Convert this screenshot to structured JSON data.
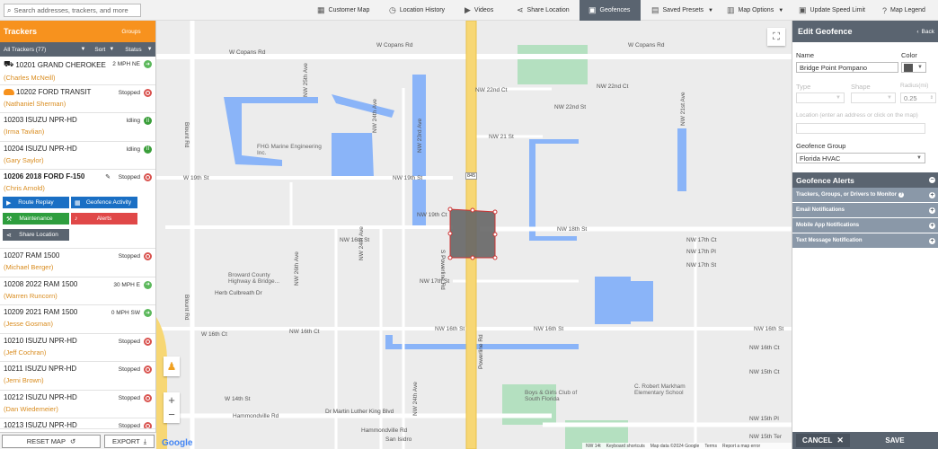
{
  "search": {
    "placeholder": "Search addresses, trackers, and more"
  },
  "nav": [
    {
      "label": "Customer Map"
    },
    {
      "label": "Location History"
    },
    {
      "label": "Videos"
    },
    {
      "label": "Share Location"
    },
    {
      "label": "Geofences"
    },
    {
      "label": "Saved Presets"
    },
    {
      "label": "Map Options"
    },
    {
      "label": "Update Speed Limit"
    },
    {
      "label": "Map Legend"
    }
  ],
  "trackers": {
    "title": "Trackers",
    "groups_label": "Groups",
    "all_label": "All Trackers (77)",
    "sort_label": "Sort",
    "status_label": "Status",
    "items": [
      {
        "name": "10201 GRAND CHEROKEE",
        "driver": "(Charles McNeill)",
        "status": "2 MPH NE",
        "state": "move"
      },
      {
        "name": "10202 FORD TRANSIT",
        "driver": "(Nathaniel Sherman)",
        "status": "Stopped",
        "state": "stop"
      },
      {
        "name": "10203 ISUZU NPR-HD",
        "driver": "(Irma Tavlian)",
        "status": "Idling",
        "state": "idle"
      },
      {
        "name": "10204 ISUZU NPR-HD",
        "driver": "(Gary Saylor)",
        "status": "Idling",
        "state": "idle"
      },
      {
        "name": "10206 2018 FORD F-150",
        "driver": "(Chris Arnold)",
        "status": "Stopped",
        "state": "stop"
      },
      {
        "name": "10207 RAM 1500",
        "driver": "(Michael Berger)",
        "status": "Stopped",
        "state": "stop"
      },
      {
        "name": "10208 2022 RAM 1500",
        "driver": "(Warren Runcorn)",
        "status": "30 MPH E",
        "state": "move"
      },
      {
        "name": "10209 2021 RAM 1500",
        "driver": "(Jesse Gosman)",
        "status": "0 MPH SW",
        "state": "move"
      },
      {
        "name": "10210 ISUZU NPR-HD",
        "driver": "(Jeff Cochran)",
        "status": "Stopped",
        "state": "stop"
      },
      {
        "name": "10211 ISUZU NPR-HD",
        "driver": "(Jerni Brown)",
        "status": "Stopped",
        "state": "stop"
      },
      {
        "name": "10212 ISUZU NPR-HD",
        "driver": "(Dan Wiedemeier)",
        "status": "Stopped",
        "state": "stop"
      },
      {
        "name": "10213 ISUZU NPR-HD",
        "driver": "",
        "status": "Stopped",
        "state": "stop"
      }
    ],
    "actions": {
      "route_replay": "Route Replay",
      "geofence_activity": "Geofence Activity",
      "maintenance": "Maintenance",
      "alerts": "Alerts",
      "share_location": "Share Location"
    },
    "reset_map": "RESET MAP",
    "export": "EXPORT"
  },
  "map": {
    "labels": [
      {
        "t": "W Copans Rd"
      },
      {
        "t": "W Copans Rd"
      },
      {
        "t": "W Copans Rd"
      },
      {
        "t": "NW 22nd Ct"
      },
      {
        "t": "NW 22nd Ct"
      },
      {
        "t": "NW 22nd St"
      },
      {
        "t": "NW 21 St"
      },
      {
        "t": "FHG Marine Engineering Inc."
      },
      {
        "t": "W 19th St"
      },
      {
        "t": "NW 19th St"
      },
      {
        "t": "NW 19th Ct"
      },
      {
        "t": "NW 18th St"
      },
      {
        "t": "NW 16th St"
      },
      {
        "t": "NW 17th St"
      },
      {
        "t": "NW 16th St"
      },
      {
        "t": "NW 16th St"
      },
      {
        "t": "Broward County Highway & Bridge..."
      },
      {
        "t": "Herb Culbreath Dr"
      },
      {
        "t": "W 16th Ct"
      },
      {
        "t": "NW 16th Ct"
      },
      {
        "t": "W 14th St"
      },
      {
        "t": "Dr Martin Luther King Blvd"
      },
      {
        "t": "Hammondville Rd"
      },
      {
        "t": "Hammondville Rd"
      },
      {
        "t": "Boys & Girls Club of South Florida"
      },
      {
        "t": "C. Robert Markham Elementary School"
      },
      {
        "t": "NW 17th Ct"
      },
      {
        "t": "NW 17th Pl"
      },
      {
        "t": "NW 17th St"
      },
      {
        "t": "NW 16th St"
      },
      {
        "t": "NW 16th Ct"
      },
      {
        "t": "NW 15th Ct"
      },
      {
        "t": "San Isidro"
      },
      {
        "t": "S Powerline Rd"
      },
      {
        "t": "Powerline Rd"
      },
      {
        "t": "NW 25th Ave"
      },
      {
        "t": "NW 24th Ave"
      },
      {
        "t": "NW 23rd Ave"
      },
      {
        "t": "NW 21st Ave"
      },
      {
        "t": "NW 26th Ave"
      },
      {
        "t": "NW 24th Ave"
      },
      {
        "t": "Blount Rd"
      },
      {
        "t": "Blount Rd"
      },
      {
        "t": "NW 24th Ave"
      },
      {
        "t": "NW 15th Pl"
      },
      {
        "t": "NW 15th Ter"
      }
    ],
    "route_shield": "845",
    "footer": {
      "google": "Google",
      "keyboard": "Keyboard shortcuts",
      "mapdata": "Map data ©2024 Google",
      "terms": "Terms",
      "report": "Report a map error",
      "nw14": "NW 14t"
    }
  },
  "geofence": {
    "title": "Edit Geofence",
    "back": "Back",
    "name_label": "Name",
    "name_value": "Bridge Point Pompano",
    "color_label": "Color",
    "type_label": "Type",
    "shape_label": "Shape",
    "radius_label": "Radius(mi)",
    "radius_value": "0.25",
    "location_label": "Location (enter an address or click on the map)",
    "group_label": "Geofence Group",
    "group_value": "Florida HVAC",
    "alerts_title": "Geofence Alerts",
    "alerts": [
      "Trackers, Groups, or Drivers to Monitor",
      "Email Notifications",
      "Mobile App Notifications",
      "Text Message Notification"
    ],
    "cancel": "CANCEL",
    "save": "SAVE"
  },
  "colors": {
    "orange": "#f7921e",
    "slate": "#5a6470",
    "route_blue": "#1a6fc4",
    "alert_red": "#e04848",
    "action_green": "#2e9e3e",
    "water": "#8ab4f8",
    "highway": "#f7d774",
    "geofence": "#666666"
  }
}
